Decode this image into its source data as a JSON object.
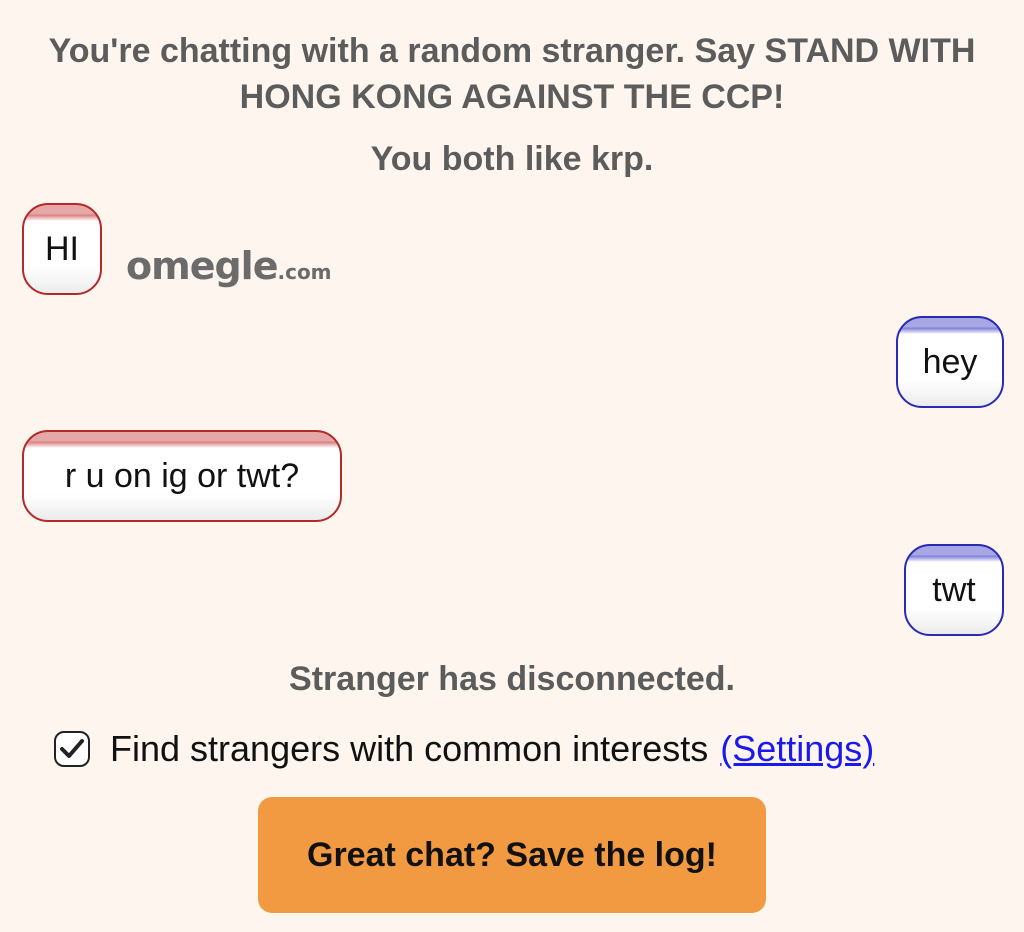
{
  "intro": {
    "line1": "You're chatting with a random stranger. Say STAND WITH",
    "line2": "HONG KONG AGAINST THE CCP!",
    "common_interests": "You both like krp."
  },
  "logo": {
    "name": "omegle",
    "suffix": ".com"
  },
  "messages": [
    {
      "sender": "stranger",
      "text": "HI"
    },
    {
      "sender": "you",
      "text": "hey"
    },
    {
      "sender": "stranger",
      "text": "r u on ig or twt?"
    },
    {
      "sender": "you",
      "text": "twt"
    }
  ],
  "status": "Stranger has disconnected.",
  "interest_option": {
    "checked": true,
    "label": "Find strangers with common interests",
    "settings_link": "(Settings)"
  },
  "save_button": {
    "label": "Great chat? Save the log!"
  },
  "colors": {
    "background": "#fdf5ee",
    "stranger_border": "#b22a2a",
    "you_border": "#2a2ab2",
    "button": "#f19a41",
    "link": "#1a1aee",
    "status_text": "#5c5c5c"
  }
}
